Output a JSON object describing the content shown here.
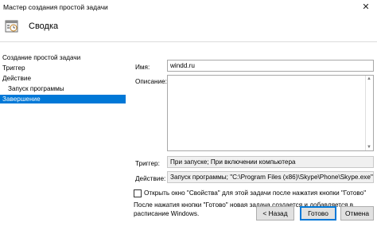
{
  "window": {
    "title": "Мастер создания простой задачи",
    "close_glyph": "✕"
  },
  "header": {
    "title": "Сводка",
    "icon": "calendar-task-icon"
  },
  "sidebar": {
    "items": [
      {
        "label": "Создание простой задачи"
      },
      {
        "label": "Триггер"
      },
      {
        "label": "Действие"
      },
      {
        "label": "Запуск программы"
      },
      {
        "label": "Завершение"
      }
    ],
    "active_index": 4
  },
  "form": {
    "name_label": "Имя:",
    "name_value": "windd.ru",
    "description_label": "Описание:",
    "description_value": "",
    "trigger_label": "Триггер:",
    "trigger_value": "При запуске; При включении компьютера",
    "action_label": "Действие:",
    "action_value": "Запуск программы; \"C:\\Program Files (x86)\\Skype\\Phone\\Skype.exe\""
  },
  "checkbox": {
    "label": "Открыть окно \"Свойства\" для этой задачи после нажатия кнопки \"Готово\"",
    "checked": false
  },
  "note": "После нажатия кнопки \"Готово\" новая задача создается и добавляется в расписание Windows.",
  "buttons": {
    "back": "< Назад",
    "finish": "Готово",
    "cancel": "Отмена"
  },
  "colors": {
    "accent": "#0078d7"
  }
}
